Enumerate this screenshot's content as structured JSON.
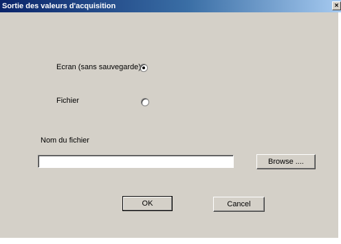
{
  "window": {
    "title": "Sortie des valeurs d'acquisition",
    "close_glyph": "×"
  },
  "output": {
    "screen_label": "Ecran (sans sauvegarde)",
    "screen_selected": true,
    "file_label": "Fichier",
    "file_selected": false
  },
  "filename": {
    "label": "Nom du fichier",
    "value": "",
    "browse_label": "Browse ...."
  },
  "buttons": {
    "ok": "OK",
    "cancel": "Cancel"
  }
}
